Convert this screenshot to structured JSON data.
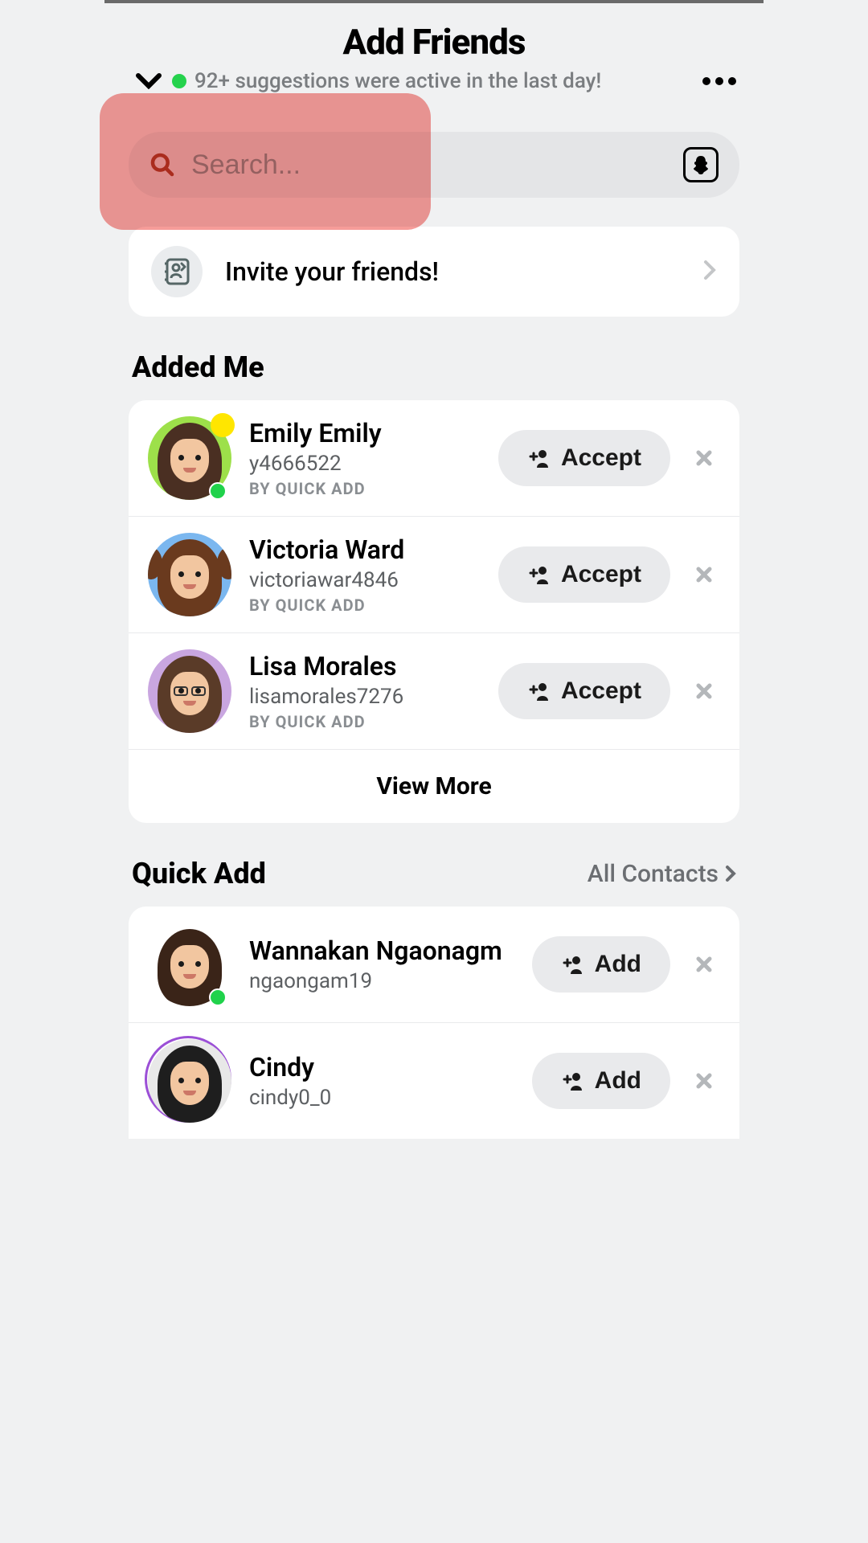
{
  "header": {
    "title": "Add Friends",
    "subtext": "92+ suggestions were active in the last day!"
  },
  "search": {
    "placeholder": "Search..."
  },
  "invite": {
    "label": "Invite your friends!"
  },
  "sections": {
    "added_me": {
      "title": "Added Me",
      "view_more": "View More",
      "items": [
        {
          "name": "Emily Emily",
          "username": "y4666522",
          "meta": "BY QUICK ADD",
          "action": "Accept",
          "badge_yellow": true,
          "badge_green": true,
          "hair": "#4a2f22",
          "shirt": "#9de04a"
        },
        {
          "name": "Victoria Ward",
          "username": "victoriawar4846",
          "meta": "BY QUICK ADD",
          "action": "Accept",
          "hair": "#6a3a1e",
          "shirt": "#7bb7ef",
          "pigtails": true
        },
        {
          "name": "Lisa Morales",
          "username": "lisamorales7276",
          "meta": "BY QUICK ADD",
          "action": "Accept",
          "hair": "#5a3b28",
          "shirt": "#c9a6e0",
          "glasses": true
        }
      ]
    },
    "quick_add": {
      "title": "Quick Add",
      "link": "All Contacts",
      "items": [
        {
          "name": "Wannakan Ngaonagm",
          "username": "ngaongam19",
          "action": "Add",
          "badge_green": true,
          "hair": "#3a2418",
          "shirt": "#ffffff"
        },
        {
          "name": "Cindy",
          "username": "cindy0_0",
          "action": "Add",
          "ring": true,
          "hair": "#1e1e1e",
          "shirt": "#e8e8e8"
        }
      ]
    }
  }
}
